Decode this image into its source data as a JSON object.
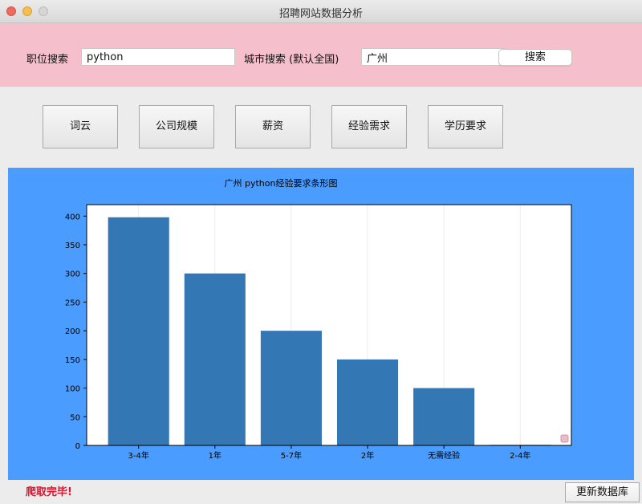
{
  "window": {
    "title": "招聘网站数据分析"
  },
  "search": {
    "job_label": "职位搜索",
    "job_value": "python",
    "city_label": "城市搜索 (默认全国)",
    "city_value": "广州",
    "button": "搜索"
  },
  "nav": [
    "词云",
    "公司规模",
    "薪资",
    "经验需求",
    "学历要求"
  ],
  "colors": {
    "band": "#f5c0cc",
    "panel": "#4a9cff",
    "bar": "#3477b5",
    "status": "#e0102a"
  },
  "chart_data": {
    "type": "bar",
    "title": "广州 python经验要求条形图",
    "categories": [
      "3-4年",
      "1年",
      "5-7年",
      "2年",
      "无需经验",
      "2-4年"
    ],
    "values": [
      398,
      300,
      200,
      150,
      100,
      1
    ],
    "yticks": [
      0,
      50,
      100,
      150,
      200,
      250,
      300,
      350,
      400
    ],
    "ylim": [
      0,
      420
    ],
    "grid": "vertical"
  },
  "status": "爬取完毕!",
  "update_button": "更新数据库"
}
